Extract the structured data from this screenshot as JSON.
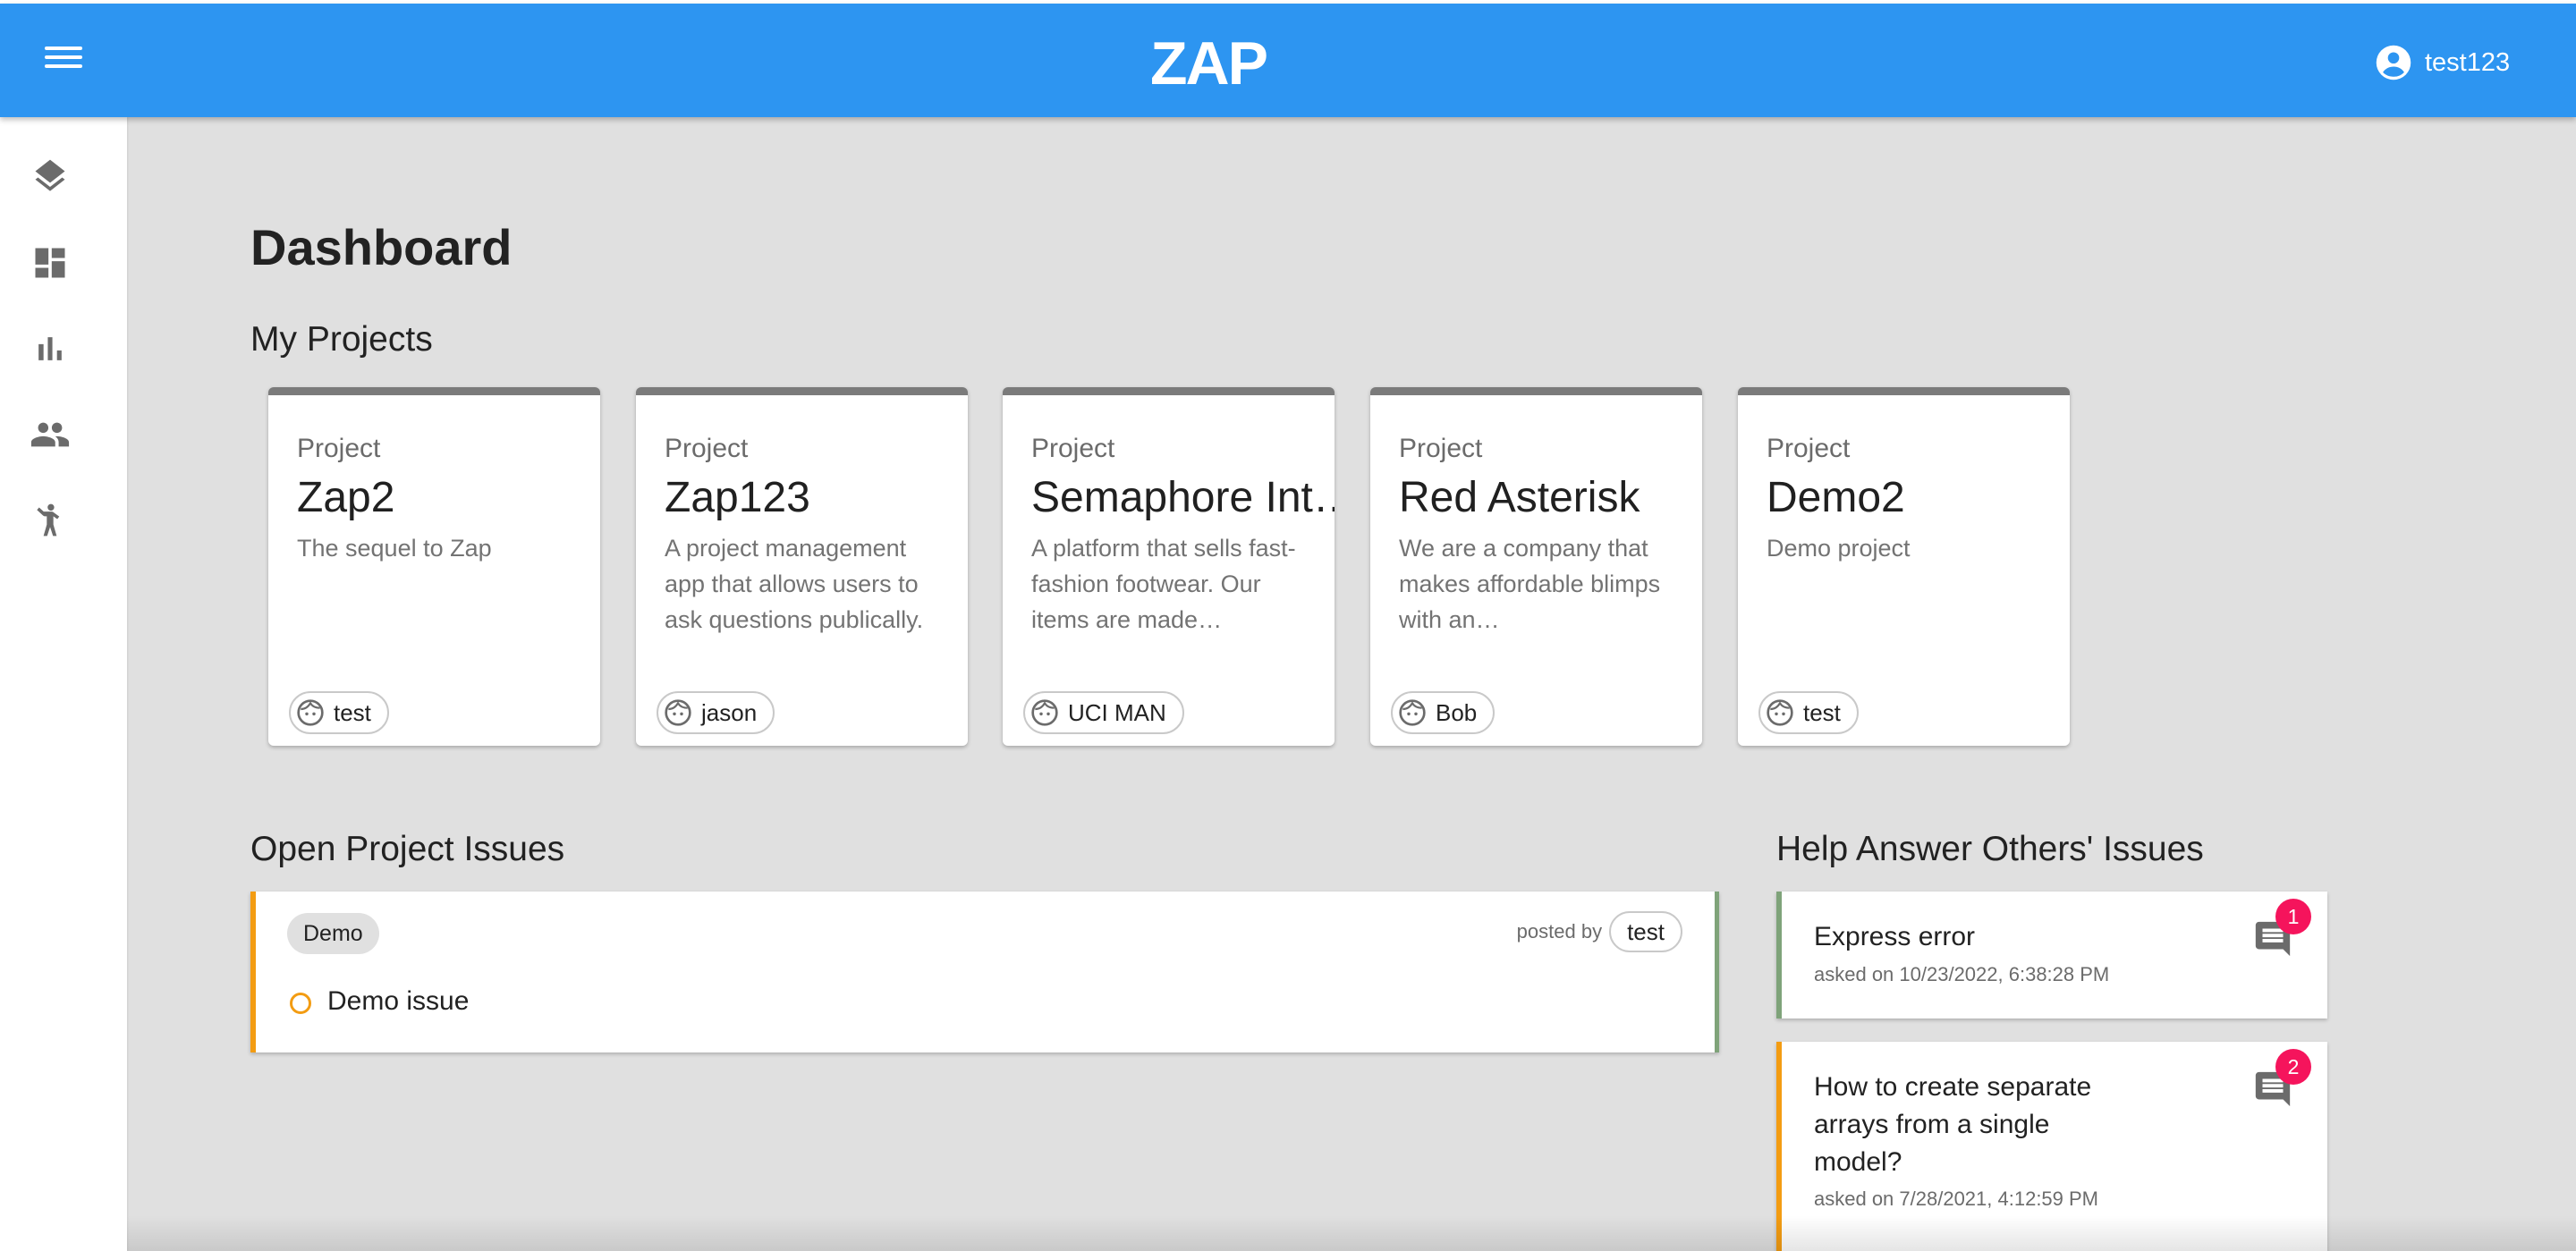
{
  "header": {
    "logo_text": "ZAP",
    "username": "test123",
    "icons": {
      "menu": "menu-icon",
      "user": "account-circle-icon"
    },
    "color": "#2d95f1"
  },
  "sidebar": {
    "items": [
      {
        "icon": "layers-icon"
      },
      {
        "icon": "dashboard-icon"
      },
      {
        "icon": "bar-chart-icon"
      },
      {
        "icon": "people-icon"
      },
      {
        "icon": "person-raising-hand-icon"
      }
    ]
  },
  "main": {
    "title": "Dashboard",
    "my_projects_heading": "My Projects",
    "projects": [
      {
        "kicker": "Project",
        "name": "Zap2",
        "description": "The sequel to Zap",
        "owner": "test"
      },
      {
        "kicker": "Project",
        "name": "Zap123",
        "description": "A project management app that allows users to ask questions publically.",
        "owner": "jason"
      },
      {
        "kicker": "Project",
        "name": "Semaphore Int…",
        "description": "A platform that sells fast-fashion footwear. Our items are made…",
        "owner": "UCI MAN"
      },
      {
        "kicker": "Project",
        "name": "Red Asterisk",
        "description": "We are a company that makes affordable blimps with an…",
        "owner": "Bob"
      },
      {
        "kicker": "Project",
        "name": "Demo2",
        "description": "Demo project",
        "owner": "test"
      }
    ],
    "open_issues_heading": "Open Project Issues",
    "open_issues": [
      {
        "tag": "Demo",
        "posted_by_label": "posted by",
        "author": "test",
        "title": "Demo issue",
        "status_color": "#f39c12"
      }
    ],
    "help_heading": "Help Answer Others' Issues",
    "help_issues": [
      {
        "question": "Express error",
        "date": "asked on 10/23/2022, 6:38:28 PM",
        "count": "1",
        "accent": "#7fa37a"
      },
      {
        "question": "How to create separate arrays from a single model?",
        "date": "asked on 7/28/2021, 4:12:59 PM",
        "count": "2",
        "accent": "#f39c12"
      }
    ]
  }
}
